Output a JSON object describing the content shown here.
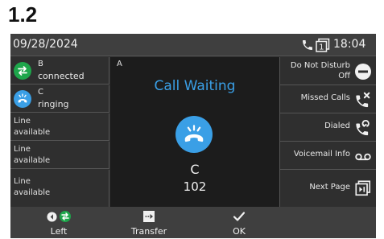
{
  "heading": "1.2",
  "status_bar": {
    "date": "09/28/2024",
    "time": "18:04",
    "line_indicator": "1",
    "icons": [
      "phone-icon",
      "line-key-icon"
    ]
  },
  "line_keys": [
    {
      "name": "B",
      "status": "connected",
      "icon": "call-connected-icon",
      "color": "#1ea64b"
    },
    {
      "name": "C",
      "status": "ringing",
      "icon": "call-ringing-icon",
      "color": "#3a9fe6"
    },
    {
      "name": "Line",
      "status": "available"
    },
    {
      "name": "Line",
      "status": "available"
    },
    {
      "name": "Line",
      "status": "available"
    }
  ],
  "center": {
    "line_label": "A",
    "title": "Call Waiting",
    "caller_name": "C",
    "caller_number": "102",
    "accent": "#3a9fe6"
  },
  "feature_keys": [
    {
      "label_line1": "Do Not Disturb",
      "label_line2": "Off",
      "icon": "do-not-disturb-icon"
    },
    {
      "label_line1": "Missed Calls",
      "icon": "missed-calls-icon"
    },
    {
      "label_line1": "Dialed",
      "icon": "dialed-calls-icon"
    },
    {
      "label_line1": "Voicemail Info",
      "icon": "voicemail-icon"
    },
    {
      "label_line1": "Next Page",
      "icon": "next-page-icon"
    }
  ],
  "softkeys": [
    {
      "label": "Left",
      "icon": "left-arrow-call-icon"
    },
    {
      "label": "Transfer",
      "icon": "transfer-icon"
    },
    {
      "label": "OK",
      "icon": "checkmark-icon"
    }
  ]
}
